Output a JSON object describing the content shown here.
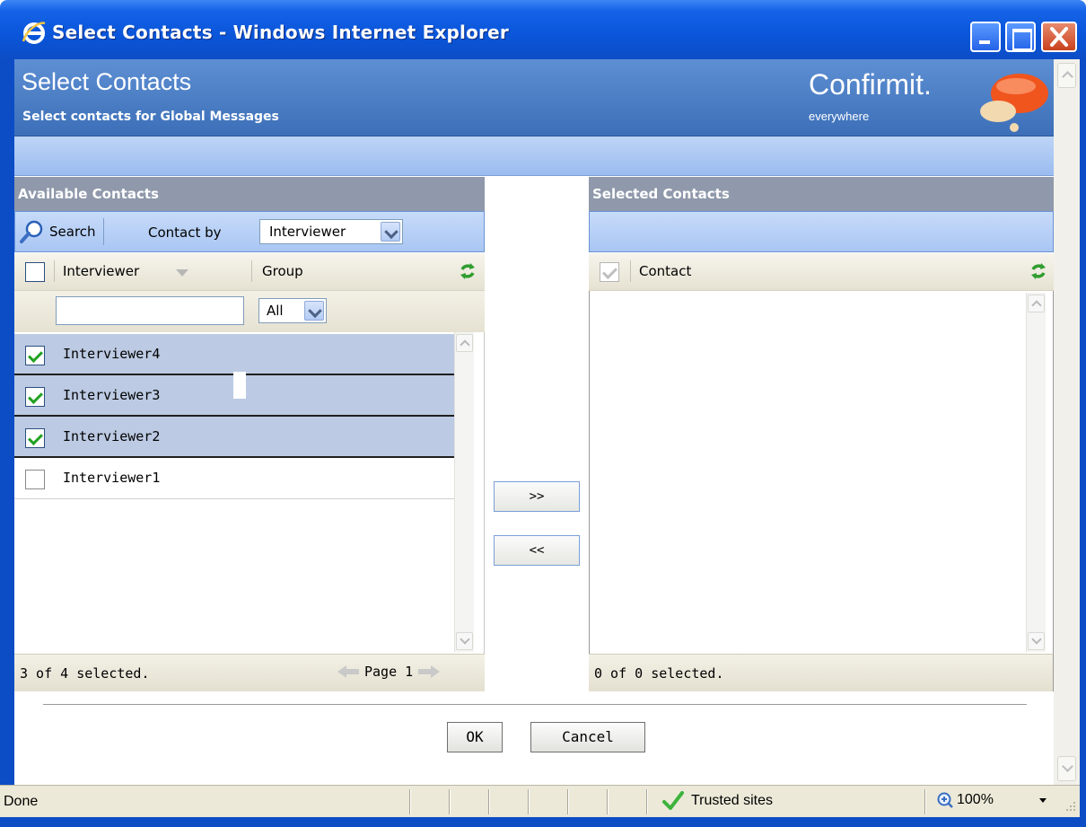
{
  "window": {
    "title": "Select Contacts - Windows Internet Explorer"
  },
  "header": {
    "title": "Select Contacts",
    "subtitle": "Select contacts for Global Messages",
    "logo_text": "Confirmit.",
    "logo_tagline": "everywhere"
  },
  "available": {
    "heading": "Available Contacts",
    "search_label": "Search",
    "contact_by_label": "Contact by",
    "contact_by_value": "Interviewer",
    "columns": [
      "Interviewer",
      "Group"
    ],
    "filter_text": "",
    "group_filter": "All",
    "rows": [
      {
        "label": "Interviewer4",
        "checked": true
      },
      {
        "label": "Interviewer3",
        "checked": true
      },
      {
        "label": "Interviewer2",
        "checked": true
      },
      {
        "label": "Interviewer1",
        "checked": false
      }
    ],
    "status": "3 of 4 selected.",
    "page_label": "Page 1"
  },
  "selected": {
    "heading": "Selected Contacts",
    "column": "Contact",
    "status": "0 of 0 selected."
  },
  "transfer": {
    "add_label": ">>",
    "remove_label": "<<"
  },
  "dialog": {
    "ok_label": "OK",
    "cancel_label": "Cancel"
  },
  "ie_status": {
    "text": "Done",
    "zone": "Trusted sites",
    "zoom": "100%"
  },
  "colors": {
    "titlebar": "#0a55d9",
    "header": "#4a7cc6",
    "panel_heading": "#8f99ab",
    "selected_row": "#bccae3",
    "check_green": "#21a121"
  }
}
